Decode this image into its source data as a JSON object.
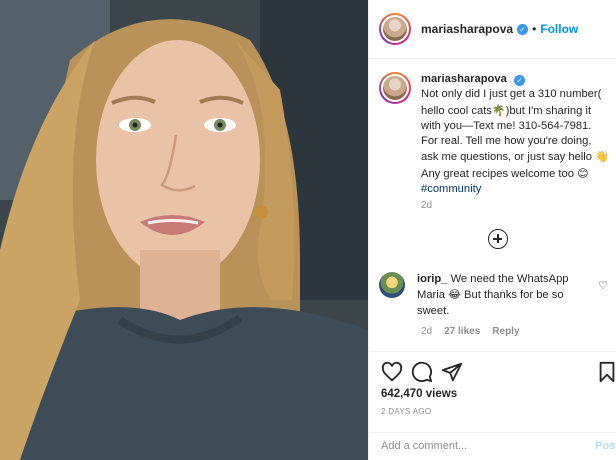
{
  "post": {
    "username": "mariasharapova",
    "follow_label": "Follow",
    "separator": "•",
    "caption_text_1": "Not only did I just get a 310 number( hello cool cats",
    "caption_emoji_1": "🌴",
    "caption_text_2": ")but I'm sharing it with you—Text me! 310-564-7981. For real. Tell me how you're doing, ask me questions, or just say hello ",
    "caption_emoji_2": "👋",
    "caption_text_3": " Any great recipes welcome too ",
    "caption_emoji_3": "😊",
    "hashtag": "#community",
    "caption_age": "2d"
  },
  "comments": [
    {
      "username": "iorip_",
      "text_1": " We need the WhatsApp Maria ",
      "emoji": "😂",
      "text_2": " But thanks for be so sweet.",
      "age": "2d",
      "likes": "27 likes",
      "reply_label": "Reply"
    }
  ],
  "stats": {
    "likes": "642,470 views",
    "date": "2 DAYS AGO"
  },
  "composer": {
    "placeholder": "Add a comment...",
    "post_label": "Post"
  },
  "icons": {
    "heart": "heart-icon",
    "comment": "comment-icon",
    "share": "share-icon",
    "save": "bookmark-icon",
    "verified": "verified-badge-icon",
    "load_more": "plus-circle-icon"
  },
  "colors": {
    "link_blue": "#0095f6",
    "hashtag": "#00376b",
    "muted": "#8e8e8e"
  }
}
